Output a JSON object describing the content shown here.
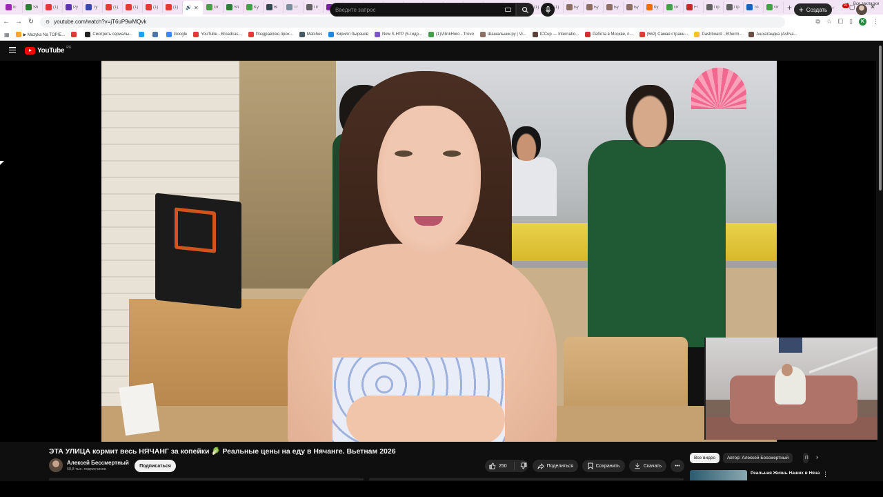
{
  "browser": {
    "tabs": [
      {
        "label": "Ic",
        "color": "#9c27b0"
      },
      {
        "label": "Sh",
        "color": "#2e7d32"
      },
      {
        "label": "(1)",
        "color": "#e53935"
      },
      {
        "label": "Py",
        "color": "#5e35b1"
      },
      {
        "label": "Ty",
        "color": "#3949ab"
      },
      {
        "label": "(1)",
        "color": "#e53935"
      },
      {
        "label": "(1)",
        "color": "#e53935"
      },
      {
        "label": "(1)",
        "color": "#e53935"
      },
      {
        "label": "(1)",
        "color": "#e53935"
      }
    ],
    "active_tab_label": "",
    "tabs_after": [
      {
        "label": "Gr",
        "color": "#43a047"
      },
      {
        "label": "Sh",
        "color": "#2e7d32"
      },
      {
        "label": "Ky",
        "color": "#43a047"
      },
      {
        "label": "Bi",
        "color": "#37474f"
      },
      {
        "label": "Tr",
        "color": "#78909c"
      },
      {
        "label": "Пr",
        "color": "#616161"
      },
      {
        "label": "Te",
        "color": "#7b1fa2"
      },
      {
        "label": "Ot",
        "color": "#7b1fa2"
      },
      {
        "label": "Ot",
        "color": "#7b1fa2"
      },
      {
        "label": "Fa",
        "color": "#1e88e5"
      },
      {
        "label": "ec",
        "color": "#7b1fa2"
      },
      {
        "label": "Ot",
        "color": "#7b1fa2"
      },
      {
        "label": "Ot",
        "color": "#7b1fa2"
      },
      {
        "label": "KH",
        "color": "#7b1fa2"
      },
      {
        "label": "ЗП",
        "color": "#7b1fa2"
      },
      {
        "label": "ec",
        "color": "#43a047"
      },
      {
        "label": "(1)",
        "color": "#e53935"
      },
      {
        "label": "(1)",
        "color": "#e53935"
      },
      {
        "label": "Бу",
        "color": "#8d6e63"
      },
      {
        "label": "Бу",
        "color": "#8d6e63"
      },
      {
        "label": "Бу",
        "color": "#8d6e63"
      },
      {
        "label": "Бу",
        "color": "#8d6e63"
      },
      {
        "label": "Ку",
        "color": "#ef6c00"
      },
      {
        "label": "Gr",
        "color": "#43a047"
      },
      {
        "label": "Fr",
        "color": "#c62828"
      },
      {
        "label": "Пр",
        "color": "#616161"
      },
      {
        "label": "Пр",
        "color": "#616161"
      },
      {
        "label": "То",
        "color": "#1565c0"
      },
      {
        "label": "Gr",
        "color": "#43a047"
      }
    ],
    "url": "youtube.com/watch?v=jT6uP9wMQvk",
    "profile_initial": "K",
    "bookmarks": [
      {
        "label": "▶ Muzyka Na TOP!E...",
        "color": "#f9a825"
      },
      {
        "label": "",
        "color": "#e53935"
      },
      {
        "label": "Смотреть сериалы...",
        "color": "#212121"
      },
      {
        "label": "",
        "color": "#1da1f2"
      },
      {
        "label": "",
        "color": "#4a76a8"
      },
      {
        "label": "Google",
        "color": "#4285f4"
      },
      {
        "label": "YouTube - Broadcas...",
        "color": "#e53935"
      },
      {
        "label": "Поздравляю прох...",
        "color": "#e53935"
      },
      {
        "label": "Matches",
        "color": "#455a64"
      },
      {
        "label": "Кирилл Зырянов",
        "color": "#1e88e5"
      },
      {
        "label": "Now S-HTP (5-гидр...",
        "color": "#7e57c2"
      },
      {
        "label": "(1)VilinkHoro - Trovo",
        "color": "#43a047"
      },
      {
        "label": "Шашальник.ру | Vi...",
        "color": "#8d6e63"
      },
      {
        "label": "ICCup — Internatio...",
        "color": "#5d4037"
      },
      {
        "label": "Работа в Москве, п...",
        "color": "#d32f2f"
      },
      {
        "label": "(562) Самая странн...",
        "color": "#e53935"
      },
      {
        "label": "Dashboard - Etherm...",
        "color": "#fbc02d"
      },
      {
        "label": "Ашхатандка (Ashva...",
        "color": "#6d4c41"
      }
    ],
    "bookmarks_right": "Все закладки"
  },
  "youtube": {
    "logo_text": "YouTube",
    "region": "RU",
    "search_placeholder": "Введите запрос",
    "create_label": "Создать",
    "notifications_count": "9+",
    "video": {
      "title": "ЭТА УЛИЦА кормит весь НЯЧАНГ за копейки 🥬 Реальные цены на еду в Нячанге. Вьетнам 2026",
      "channel": "Алексей Бессмертный",
      "subscribers": "58,8 тыс. подписчиков",
      "subscribe_label": "Подписаться",
      "likes": "250",
      "share_label": "Поделиться",
      "save_label": "Сохранить",
      "download_label": "Скачать"
    },
    "chips": {
      "all": "Все видео",
      "author": "Автор: Алексей Бессмертный",
      "more": "П"
    },
    "recommended": {
      "title": "Реальная Жизнь Наших в Нячанге | Как Работать и Ст..."
    }
  },
  "colors": {
    "background": "#0f0f0f",
    "youtube_red": "#ff0000",
    "pill": "#272727"
  }
}
